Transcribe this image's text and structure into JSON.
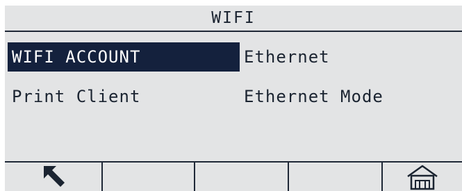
{
  "title": "WIFI",
  "menu": {
    "items": [
      {
        "label": "WIFI ACCOUNT",
        "selected": true
      },
      {
        "label": "Ethernet",
        "selected": false
      },
      {
        "label": "Print Client",
        "selected": false
      },
      {
        "label": "Ethernet Mode",
        "selected": false
      }
    ]
  },
  "softkeys": [
    {
      "icon": "back-arrow-icon"
    },
    {
      "icon": ""
    },
    {
      "icon": ""
    },
    {
      "icon": ""
    },
    {
      "icon": "home-icon"
    }
  ],
  "colors": {
    "background": "#e3e4e5",
    "selected_background": "#14213d",
    "selected_text": "#ffffff",
    "text": "#1b2431"
  }
}
